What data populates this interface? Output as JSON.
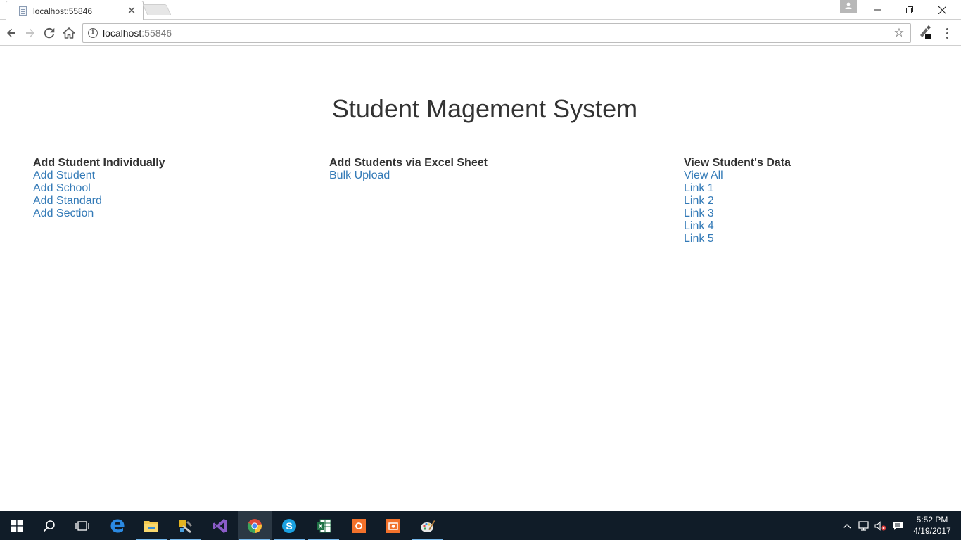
{
  "browser": {
    "tab": {
      "title": "localhost:55846",
      "close_glyph": "✕"
    },
    "address": {
      "host": "localhost",
      "port": ":55846"
    },
    "window_controls": {
      "minimize": "—",
      "maximize": "❐",
      "close": "✕"
    }
  },
  "page": {
    "title": "Student Magement System",
    "columns": [
      {
        "heading": "Add Student Individually",
        "links": [
          "Add Student",
          "Add School",
          "Add Standard",
          "Add Section"
        ]
      },
      {
        "heading": "Add Students via Excel Sheet",
        "links": [
          "Bulk Upload"
        ]
      },
      {
        "heading": "View Student's Data",
        "links": [
          "View All",
          "Link 1",
          "Link 2",
          "Link 3",
          "Link 4",
          "Link 5"
        ]
      }
    ]
  },
  "taskbar": {
    "items": [
      {
        "name": "start-button",
        "icon": "windows-logo-icon"
      },
      {
        "name": "search-button",
        "icon": "search-icon"
      },
      {
        "name": "task-view-button",
        "icon": "task-view-icon"
      },
      {
        "name": "edge-app",
        "icon": "edge-icon"
      },
      {
        "name": "file-explorer-app",
        "icon": "folder-icon"
      },
      {
        "name": "tools-app",
        "icon": "tools-icon"
      },
      {
        "name": "visual-studio-app",
        "icon": "visual-studio-icon"
      },
      {
        "name": "chrome-app",
        "icon": "chrome-icon"
      },
      {
        "name": "skype-app",
        "icon": "skype-icon"
      },
      {
        "name": "excel-app",
        "icon": "excel-icon"
      },
      {
        "name": "orange-app-1",
        "icon": "orange-app-icon"
      },
      {
        "name": "orange-app-2",
        "icon": "camera-app-icon"
      },
      {
        "name": "paint-app",
        "icon": "paint-icon"
      }
    ],
    "clock": {
      "time": "5:52 PM",
      "date": "4/19/2017"
    }
  },
  "colors": {
    "link": "#337ab7",
    "text": "#333333",
    "taskbar": "#101c28",
    "taskbar_accent": "#76b9ed"
  }
}
